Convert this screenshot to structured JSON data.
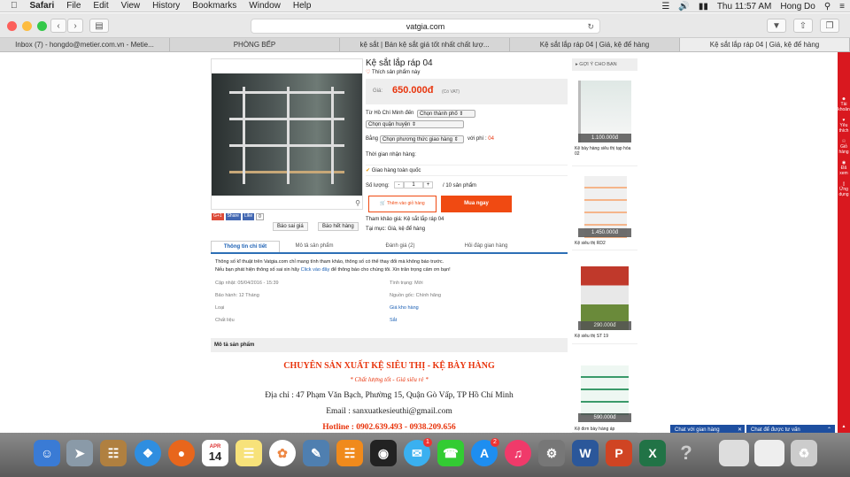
{
  "menubar": {
    "app": "Safari",
    "items": [
      "File",
      "Edit",
      "View",
      "History",
      "Bookmarks",
      "Window",
      "Help"
    ],
    "clock": "Thu 11:57 AM",
    "user": "Hong Do"
  },
  "toolbar": {
    "url": "vatgia.com"
  },
  "tabs": [
    "Inbox (7) - hongdo@metier.com.vn - Metie...",
    "PHÒNG BẾP",
    "kệ sắt | Bán kệ sắt giá tốt nhất chất lượ...",
    "Kệ sắt lắp ráp 04 | Giá, kệ để hàng",
    "Kệ sắt lắp ráp 04 | Giá, kệ để hàng"
  ],
  "product": {
    "title": "Kệ sắt lắp ráp 04",
    "like": "Thích sản phẩm này",
    "price_label": "Giá:",
    "price": "650.000đ",
    "vat": "(Có VAT)",
    "from_label": "Từ Hồ Chí Minh đến",
    "city_select": "Chọn thành phố",
    "district_select": "Chọn quận huyện",
    "by_label": "Bằng",
    "method_select": "Chọn phương thức giao hàng",
    "fee_label": "với phí :",
    "fee_value": "04",
    "time_label": "Thời gian nhận hàng:",
    "nationwide": "Giao hàng toàn quốc",
    "qty_label": "Số lượng:",
    "qty_minus": "-",
    "qty_value": "1",
    "qty_plus": "+",
    "qty_stock": "/ 10 sản phẩm",
    "add_cart": "Thêm vào giỏ hàng",
    "buy_now": "Mua ngay",
    "ref_label": "Tham khảo giá:",
    "ref_value": "Kệ sắt lắp ráp 04",
    "category_label": "Tại mục:",
    "category_value": "Giá, kệ để hàng",
    "report_wrong": "Báo sai giá",
    "report_out": "Báo hết hàng",
    "social": {
      "gplus": "G+1",
      "share": "Share",
      "like": "Like",
      "count": "0"
    }
  },
  "detail_tabs": [
    "Thông tin chi tiết",
    "Mô tả sản phẩm",
    "Đánh giá (2)",
    "Hỏi đáp gian hàng"
  ],
  "detail": {
    "note1": "Thông số kĩ thuật trên Vatgia.com chỉ mang tính tham khảo, thông số có thể thay đổi mà không báo trước.",
    "note2a": "Nếu bạn phát hiện thông số sai xin hãy",
    "note2link": "Click vào đây",
    "note2b": "để thông báo cho chúng tôi. Xin trân trọng cảm ơn bạn!",
    "left": [
      {
        "k": "Cập nhật:",
        "v": "05/04/2016 - 15:39"
      },
      {
        "k": "Bảo hành:",
        "v": "12 Tháng"
      },
      {
        "k": "Loại",
        "v": ""
      },
      {
        "k": "Chất liệu",
        "v": ""
      }
    ],
    "right": [
      {
        "k": "Tình trạng:",
        "v": "Mới"
      },
      {
        "k": "Nguồn gốc:",
        "v": "Chính hãng"
      },
      {
        "k": "",
        "v": "Giá kho hàng"
      },
      {
        "k": "",
        "v": "Sắt"
      }
    ]
  },
  "desc": {
    "header": "Mô tả sản phẩm",
    "line1": "CHUYÊN SẢN XUẤT KỆ SIÊU THỊ - KỆ BÀY HÀNG",
    "line2": "* Chất lượng tốt - Giá siêu rẻ *",
    "line3": "Địa chỉ : 47 Phạm Văn Bạch, Phường 15, Quận Gò Vấp, TP Hồ Chí Minh",
    "line4": "Email : sanxuatkesieuthi@gmail.com",
    "line5": "Hotline : 0902.639.493 - 0938.209.656"
  },
  "suggest": {
    "title": "GỢI Ý CHO BẠN",
    "items": [
      {
        "price": "1.100.000đ",
        "name": "Kệ bày hàng siêu thị tạp hóa 02"
      },
      {
        "price": "1.450.000đ",
        "name": "Kệ siêu thị RD2"
      },
      {
        "price": "290.000đ",
        "name": "Kệ siêu thị ST 19"
      },
      {
        "price": "590.000đ",
        "name": "Kệ đơn bày hàng áp"
      }
    ]
  },
  "side": {
    "items": [
      "Tài khoản",
      "Yêu thích",
      "Giỏ hàng",
      "Đã xem",
      "Ứng dụng"
    ]
  },
  "chat": {
    "shop": "Chat với gian hàng",
    "staff": "Chat để được tư vấn"
  },
  "dock": {
    "date_month": "APR",
    "date_day": "14",
    "badge1": "1",
    "badge2": "2"
  }
}
